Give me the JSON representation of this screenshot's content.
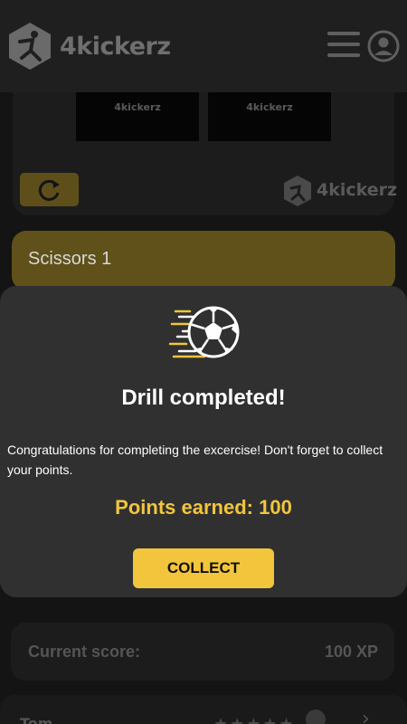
{
  "header": {
    "brand": "4kickerz",
    "icons": {
      "logo": "kicker-hexagon-logo",
      "menu": "hamburger-menu-icon",
      "account": "user-account-icon"
    }
  },
  "video": {
    "thumb_label_1": "4kickerz",
    "thumb_label_2": "4kickerz",
    "watermark": "4kickerz",
    "replay_icon": "refresh-icon"
  },
  "drill": {
    "title": "Scissors 1"
  },
  "modal": {
    "icon": "soccer-ball-speed-icon",
    "title": "Drill completed!",
    "body": "Congratulations for completing the excercise! Don't forget to collect your points.",
    "points": "Points earned: 100",
    "collect_label": "COLLECT"
  },
  "score": {
    "label": "Current score:",
    "value": "100 XP"
  },
  "bottom": {
    "name": "Tom",
    "stars": "★★★★★"
  },
  "colors": {
    "accent": "#f2c53d",
    "modal_bg": "#303030",
    "background": "#141414"
  }
}
